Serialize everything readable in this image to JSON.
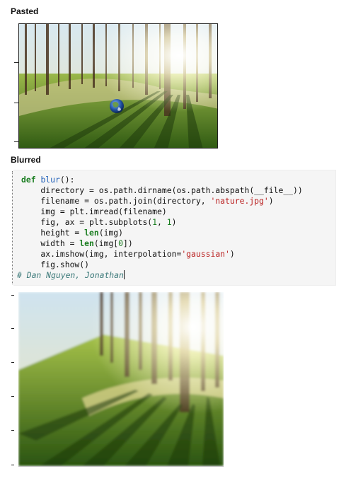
{
  "sections": {
    "pasted_title": "Pasted",
    "blurred_title": "Blurred"
  },
  "code": {
    "comment": "# Dan Nguyen, Jonathan",
    "lines": [
      [
        {
          "t": "def ",
          "c": "kw"
        },
        {
          "t": "blur",
          "c": "fn"
        },
        {
          "t": "():",
          "c": ""
        }
      ],
      [
        {
          "t": "    directory = os.path.dirname(os.path.abspath(__file__))",
          "c": ""
        }
      ],
      [
        {
          "t": "    filename = os.path.join(directory, ",
          "c": ""
        },
        {
          "t": "'nature.jpg'",
          "c": "str"
        },
        {
          "t": ")",
          "c": ""
        }
      ],
      [
        {
          "t": "    img = plt.imread(filename)",
          "c": ""
        }
      ],
      [
        {
          "t": "    fig, ax = plt.subplots(",
          "c": ""
        },
        {
          "t": "1",
          "c": "num"
        },
        {
          "t": ", ",
          "c": ""
        },
        {
          "t": "1",
          "c": "num"
        },
        {
          "t": ")",
          "c": ""
        }
      ],
      [
        {
          "t": "    height = ",
          "c": ""
        },
        {
          "t": "len",
          "c": "kw"
        },
        {
          "t": "(img)",
          "c": ""
        }
      ],
      [
        {
          "t": "    width = ",
          "c": ""
        },
        {
          "t": "len",
          "c": "kw"
        },
        {
          "t": "(img[",
          "c": ""
        },
        {
          "t": "0",
          "c": "num"
        },
        {
          "t": "])",
          "c": ""
        }
      ],
      [
        {
          "t": "    ax.imshow(img, interpolation=",
          "c": ""
        },
        {
          "t": "'gaussian'",
          "c": "str"
        },
        {
          "t": ")",
          "c": ""
        }
      ],
      [
        {
          "t": "    fig.show()",
          "c": ""
        }
      ]
    ]
  },
  "images": {
    "pasted_alt": "forest scene with pasted earth globe",
    "blurred_alt": "gaussian blurred forest scene"
  },
  "colors": {
    "sky": "#cfe3ef",
    "grass": "#5a8a1a",
    "trunk": "#4a3420",
    "sun": "#fffbe0",
    "globe_ocean": "#1f4fa0",
    "globe_land": "#6b9a3a"
  }
}
